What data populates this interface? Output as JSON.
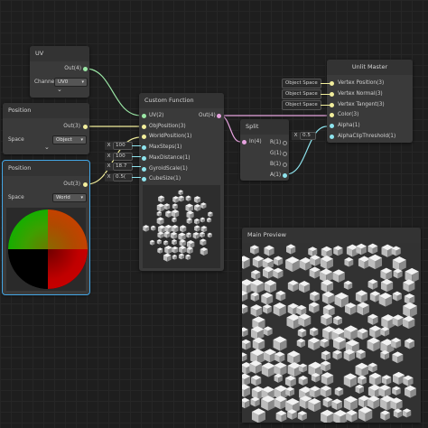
{
  "nodes": {
    "uv": {
      "title": "UV",
      "port_out": "Out(4)",
      "channel_label": "Channe",
      "channel_value": "UV0"
    },
    "pos_obj": {
      "title": "Position",
      "port_out": "Out(3)",
      "space_label": "Space",
      "space_value": "Object"
    },
    "pos_world": {
      "title": "Position",
      "port_out": "Out(3)",
      "space_label": "Space",
      "space_value": "World"
    },
    "custom": {
      "title": "Custom Function",
      "inputs": [
        "UV(2)",
        "ObjPosition(3)",
        "WorldPosition(1)",
        "MaxSteps(1)",
        "MaxDistance(1)",
        "GyroidScale(1)",
        "CubeSize(1)"
      ],
      "output": "Out(4)"
    },
    "split": {
      "title": "Split",
      "input": "In(4)",
      "outputs": [
        "R(1)",
        "G(1)",
        "B(1)",
        "A(1)"
      ]
    },
    "master": {
      "title": "Unlit Master",
      "inputs": [
        "Vertex Position(3)",
        "Vertex Normal(3)",
        "Vertex Tangent(3)",
        "Color(3)",
        "Alpha(1)",
        "AlphaClipThreshold(1)"
      ]
    },
    "preview": {
      "title": "Main Preview"
    }
  },
  "object_space_pills": [
    "Object Space",
    "Object Space",
    "Object Space"
  ],
  "x_fields": [
    {
      "axis": "X",
      "value": "100"
    },
    {
      "axis": "X",
      "value": "100"
    },
    {
      "axis": "X",
      "value": "18.7"
    },
    {
      "axis": "X",
      "value": "0.5("
    }
  ],
  "alpha_clip_field": {
    "axis": "X",
    "value": "0.5"
  },
  "arrow_glyph": "▾",
  "chevron_glyph": "⌄",
  "colors": {
    "background": "#1e1e1e",
    "node": "#3a3a3a",
    "selected_outline": "#43a7e6",
    "vec4_wire": "#e6a3df",
    "vec3_wire": "#f2ee9c",
    "vec2_wire": "#9be8a6",
    "float_wire": "#8ee4ee"
  }
}
